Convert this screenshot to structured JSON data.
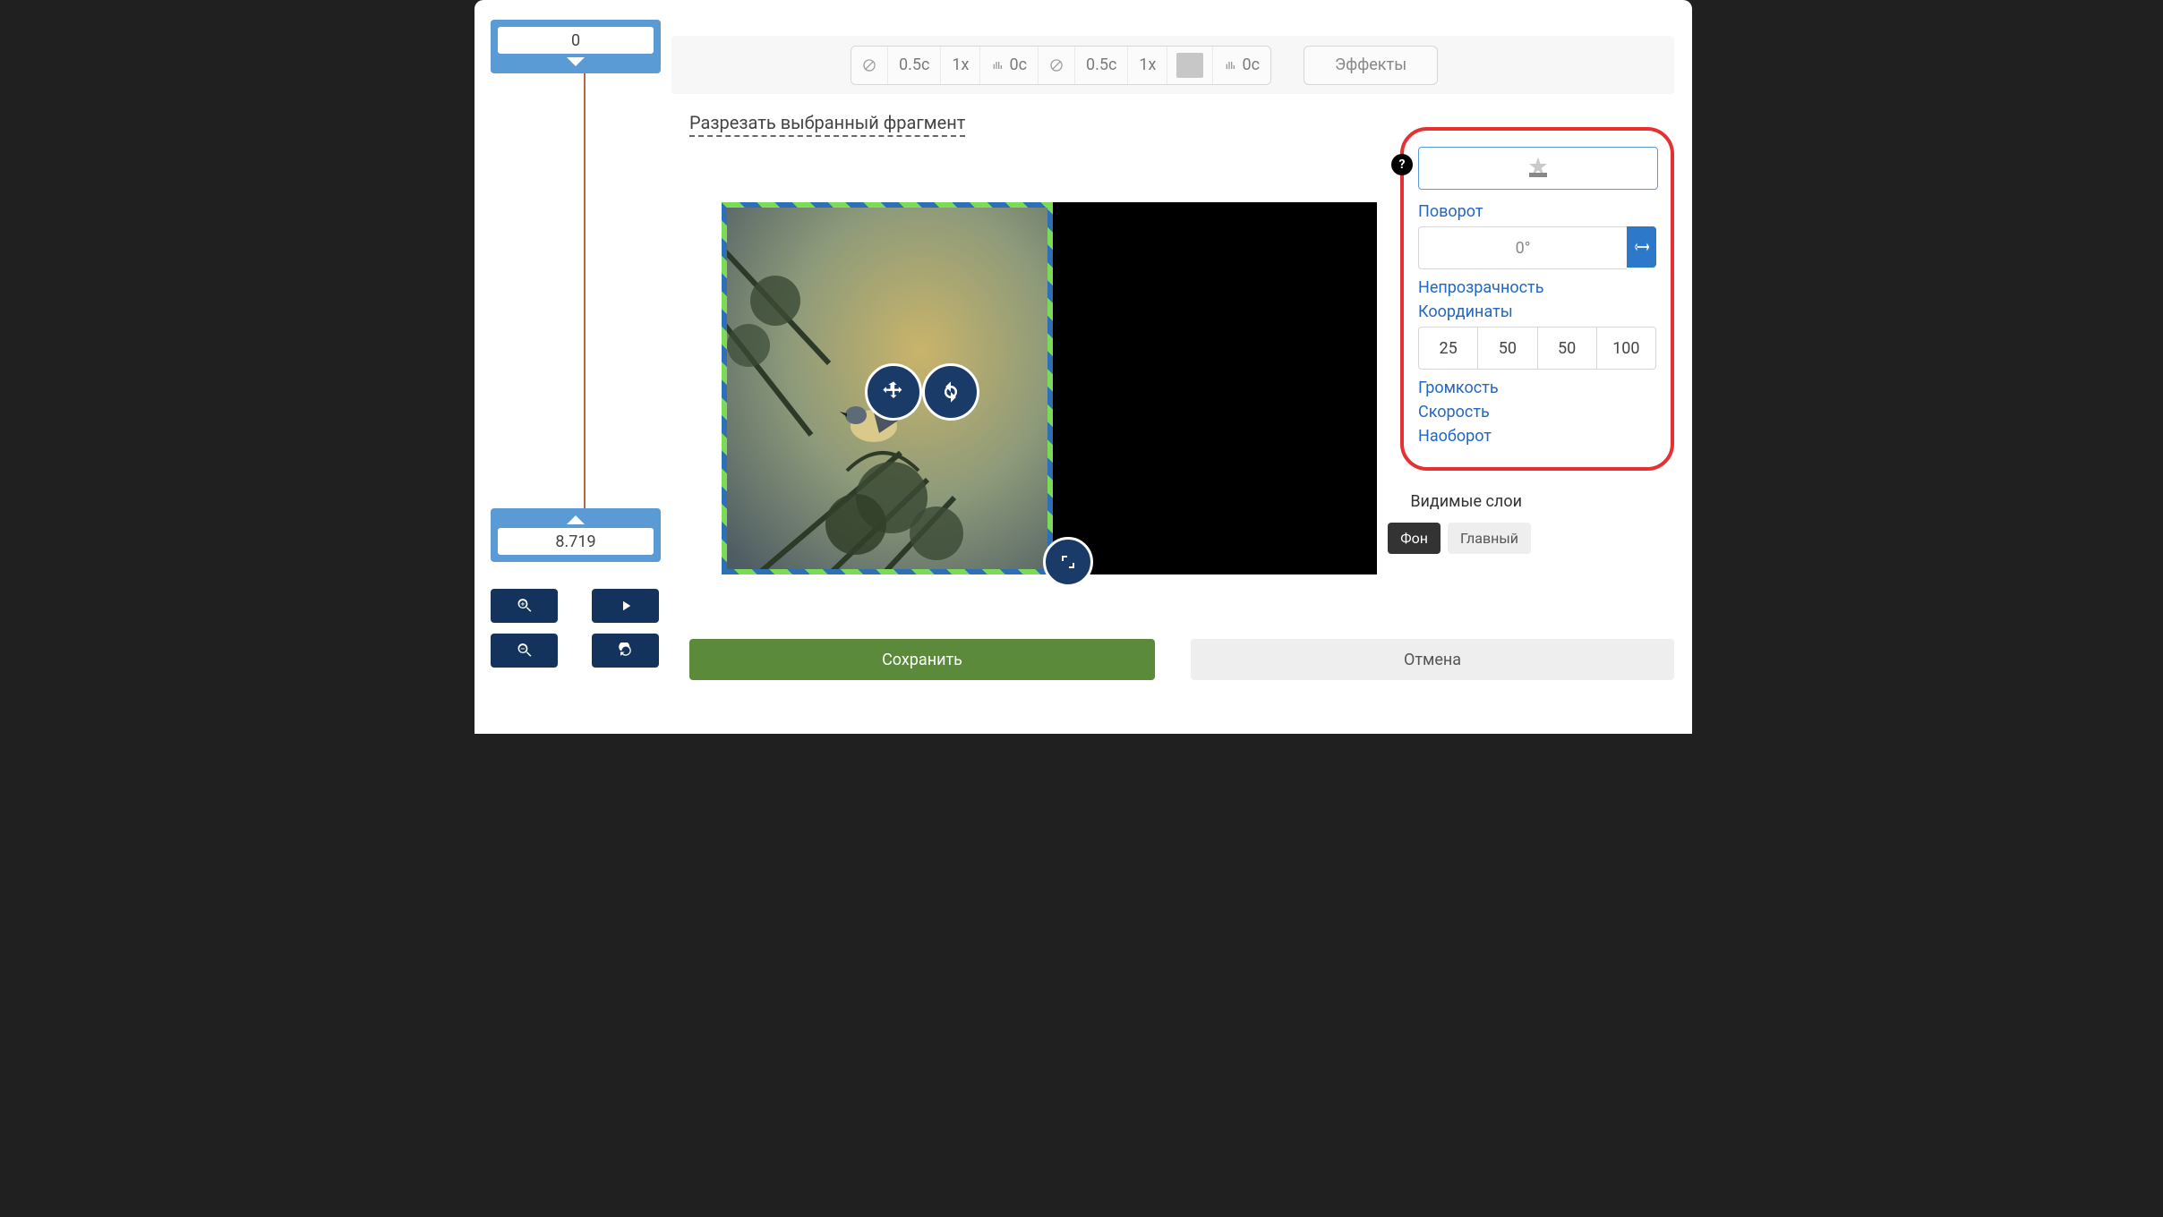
{
  "timeline": {
    "start_value": "0",
    "end_value": "8.719"
  },
  "toolbar": {
    "group1": {
      "disable_icon": "⊘",
      "duration": "0.5с",
      "speed": "1x",
      "vol_icon": "vol",
      "vol_time": "0с"
    },
    "group2": {
      "disable_icon": "⊘",
      "duration": "0.5с",
      "speed": "1x",
      "swatch": true,
      "vol_icon": "vol",
      "vol_time": "0с"
    },
    "effects_label": "Эффекты"
  },
  "cut_link": "Разрезать выбранный фрагмент",
  "props": {
    "help": "?",
    "rotation_label": "Поворот",
    "rotation_value": "0°",
    "opacity_label": "Непрозрачность",
    "coords_label": "Координаты",
    "coords": [
      "25",
      "50",
      "50",
      "100"
    ],
    "volume_label": "Громкость",
    "speed_label": "Скорость",
    "reverse_label": "Наоборот"
  },
  "layers": {
    "title": "Видимые слои",
    "bg": "Фон",
    "main": "Главный"
  },
  "footer": {
    "save": "Сохранить",
    "cancel": "Отмена"
  }
}
